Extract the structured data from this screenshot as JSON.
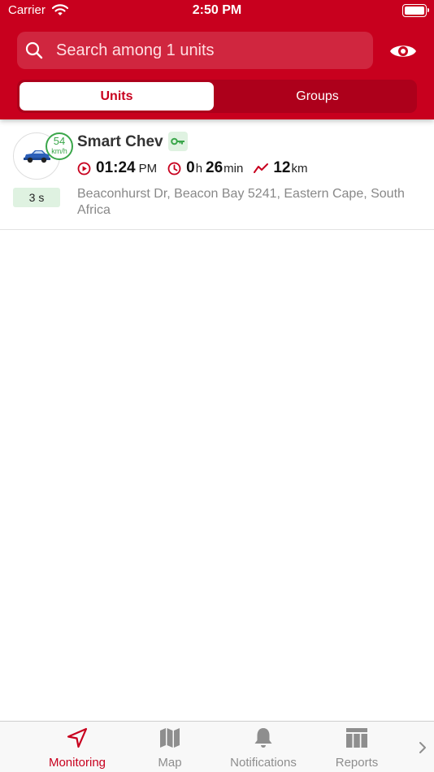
{
  "status_bar": {
    "carrier": "Carrier",
    "time": "2:50 PM"
  },
  "search": {
    "placeholder": "Search among 1 units"
  },
  "segments": {
    "units": "Units",
    "groups": "Groups"
  },
  "units": [
    {
      "name": "Smart Chev",
      "speed": "54",
      "speed_unit": "km/h",
      "last_update": "3 s",
      "time_value": "01:24",
      "time_suffix": "PM",
      "duration_hours": "0",
      "duration_h_label": "h",
      "duration_minutes": "26",
      "duration_min_label": "min",
      "distance": "12",
      "distance_unit": "km",
      "address": "Beaconhurst Dr, Beacon Bay 5241, Eastern Cape, South Africa"
    }
  ],
  "tabbar": {
    "items": [
      {
        "label": "Monitoring",
        "icon": "navigation-arrow-icon",
        "active": true
      },
      {
        "label": "Map",
        "icon": "map-icon",
        "active": false
      },
      {
        "label": "Notifications",
        "icon": "bell-icon",
        "active": false
      },
      {
        "label": "Reports",
        "icon": "table-icon",
        "active": false
      }
    ]
  },
  "colors": {
    "brand": "#c8001e",
    "online_green": "#3aa64a",
    "inactive_gray": "#8e8e8e"
  }
}
